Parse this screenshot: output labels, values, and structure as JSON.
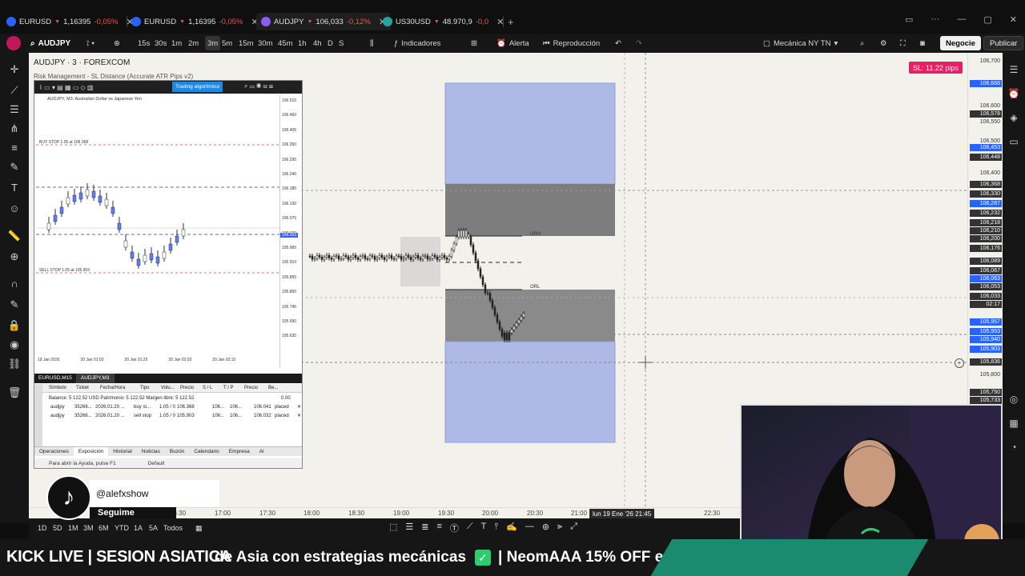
{
  "tabs": [
    {
      "symbol": "EURUSD",
      "price": "1,16395",
      "change": "-0,05%"
    },
    {
      "symbol": "EURUSD",
      "price": "1,16395",
      "change": "-0,05%"
    },
    {
      "symbol": "AUDJPY",
      "price": "106,033",
      "change": "-0,12%"
    },
    {
      "symbol": "US30USD",
      "price": "48.970,9",
      "change": "-0,0"
    }
  ],
  "toolbar": {
    "symbol": "AUDJPY",
    "timeframes": [
      "15s",
      "30s",
      "1m",
      "2m",
      "3m",
      "5m",
      "15m",
      "30m",
      "45m",
      "1h",
      "4h",
      "D",
      "S"
    ],
    "selected_timeframe": "3m",
    "indicators": "Indicadores",
    "alert": "Alerta",
    "replay": "Reproducción",
    "layout_name": "Mecánica NY TN",
    "trade_btn": "Negocie",
    "publish_btn": "Publicar"
  },
  "chart": {
    "title": "AUDJPY · 3 · FOREXCOM",
    "indicator": "Risk Management - SL Distance (Accurate ATR Pips v2)",
    "sl_badge": "SL: 11.22 pips",
    "orh_label": "ORH",
    "orl_label": "ORL",
    "prices": [
      {
        "v": "106,700",
        "style": ""
      },
      {
        "v": "106,668",
        "style": "b"
      },
      {
        "v": "106,600",
        "style": ""
      },
      {
        "v": "106,578",
        "style": "d"
      },
      {
        "v": "106,550",
        "style": ""
      },
      {
        "v": "106,500",
        "style": ""
      },
      {
        "v": "106,453",
        "style": "b"
      },
      {
        "v": "106,448",
        "style": "d"
      },
      {
        "v": "106,400",
        "style": ""
      },
      {
        "v": "106,368",
        "style": "d"
      },
      {
        "v": "106,330",
        "style": "d"
      },
      {
        "v": "106,287",
        "style": "b"
      },
      {
        "v": "106,232",
        "style": "d"
      },
      {
        "v": "106,218",
        "style": "d"
      },
      {
        "v": "106,210",
        "style": "d"
      },
      {
        "v": "106,200",
        "style": "d"
      },
      {
        "v": "106,176",
        "style": "d"
      },
      {
        "v": "106,089",
        "style": "d"
      },
      {
        "v": "106,067",
        "style": "d"
      },
      {
        "v": "106,063",
        "style": "b"
      },
      {
        "v": "106,053",
        "style": "d"
      },
      {
        "v": "106,033",
        "style": "d"
      },
      {
        "v": "02:17",
        "style": "d"
      },
      {
        "v": "105,957",
        "style": "b"
      },
      {
        "v": "105,953",
        "style": "b"
      },
      {
        "v": "105,940",
        "style": "b"
      },
      {
        "v": "105,903",
        "style": "b"
      },
      {
        "v": "105,836",
        "style": "d"
      },
      {
        "v": "105,800",
        "style": ""
      },
      {
        "v": "105,750",
        "style": "d"
      },
      {
        "v": "105,733",
        "style": "d"
      }
    ],
    "times": [
      "16:30",
      "17:00",
      "17:30",
      "18:00",
      "18:30",
      "19:00",
      "19:30",
      "20:00",
      "20:30",
      "21:00",
      "22:30"
    ],
    "crosshair_time": "lun 19 Ene '26  21:45",
    "crosshair_prefix": "lun 19",
    "ranges": [
      "1D",
      "5D",
      "1M",
      "3M",
      "6M",
      "YTD",
      "1A",
      "5A",
      "Todos"
    ]
  },
  "mt": {
    "symbol_line": "AUDJPY, M3: Australian Dollar vs Japanese Yen",
    "algo_btn": "Trading algorítmico",
    "buy_stop": "BUY STOP 1.05 at 106.368",
    "sell_stop": "SELL STOP 1.05 at 105.903",
    "prices": [
      "106.515",
      "106.460",
      "106.405",
      "106.350",
      "106.295",
      "106.240",
      "106.185",
      "106.130",
      "106.075",
      "106.020",
      "105.965",
      "105.910",
      "105.855",
      "105.800",
      "105.745",
      "105.690",
      "105.635"
    ],
    "price_tag": "106.033",
    "times": [
      "19 Jan 2026",
      "20 Jan 01:03",
      "20 Jan 01:25",
      "20 Jan 02:03",
      "20 Jan 02:15"
    ],
    "chart_tabs": [
      "EURUSD,M15",
      "AUDJPY,M3"
    ],
    "columns": [
      "Símbolo",
      "Ticket",
      "Fecha/Hora",
      "Tipo",
      "Volu...",
      "Precio",
      "S / L",
      "T / P",
      "Precio",
      "Be..."
    ],
    "balance": "Balance: 5 122.52 USD  Patrimonio: 5 122.52  Margen libre: 5 122.52",
    "balance_value": "0.00",
    "rows": [
      {
        "sym": "audjpy",
        "ticket": "35266...",
        "date": "2026.01.20 ...",
        "type": "buy st...",
        "vol": "1.05 / 0",
        "price": "106.368",
        "sl": "106...",
        "tp": "106...",
        "cur": "106.041",
        "state": "placed"
      },
      {
        "sym": "audjpy",
        "ticket": "35266...",
        "date": "2026.01.20 ...",
        "type": "sell stop",
        "vol": "1.05 / 0",
        "price": "105.903",
        "sl": "106...",
        "tp": "106...",
        "cur": "106.032",
        "state": "placed"
      }
    ],
    "terminal_tabs": [
      "Operaciones",
      "Exposición",
      "Historial",
      "Noticias",
      "Buzón",
      "Calendario",
      "Empresa",
      "Al"
    ],
    "status": "Para abrir la Ayuda, pulse F1",
    "status2": "Default"
  },
  "tiktok": {
    "handle": "@alefxshow",
    "follow": "Seguime"
  },
  "ticker": {
    "text1": "KICK LIVE | SESION ASIATICA",
    "text2": "de Asia con estrategias mecánicas",
    "text3": "| NeomAAA 15% OFF e"
  },
  "colors": {
    "bg": "#f3f1ec",
    "blue_zone": "#aeb9e6",
    "gray_zone": "#7a7a7a",
    "accent": "#2962ff",
    "sl": "#e91e63"
  }
}
